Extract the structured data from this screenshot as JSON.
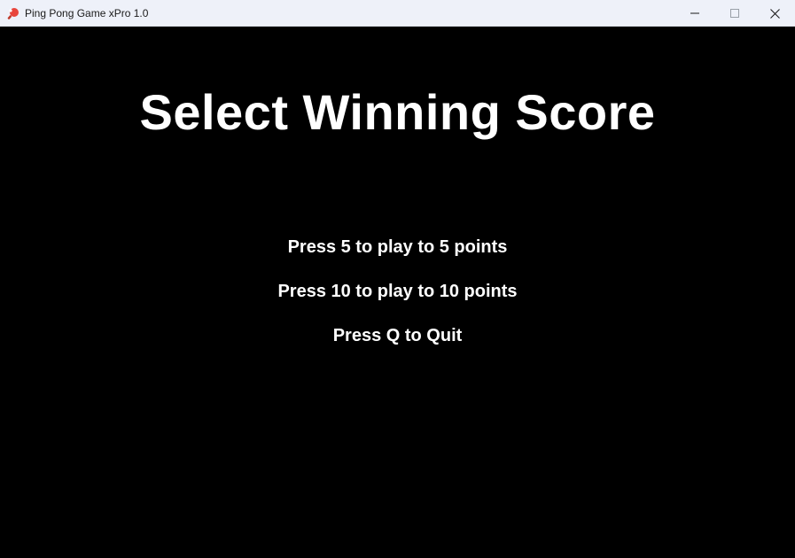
{
  "window": {
    "title": "Ping Pong Game xPro 1.0",
    "app_icon": "ping-pong-paddle-icon",
    "controls": {
      "minimize_icon": "minimize-icon",
      "maximize_icon": "maximize-icon",
      "close_icon": "close-icon"
    }
  },
  "menu": {
    "heading": "Select Winning Score",
    "options": [
      {
        "label": "Press 5 to play to 5 points",
        "key": "5"
      },
      {
        "label": "Press 10 to play to 10 points",
        "key": "10"
      },
      {
        "label": "Press Q to Quit",
        "key": "Q"
      }
    ]
  },
  "colors": {
    "background": "#000000",
    "text": "#ffffff",
    "titlebar": "#eef1f9",
    "paddle_red": "#e8453c"
  }
}
